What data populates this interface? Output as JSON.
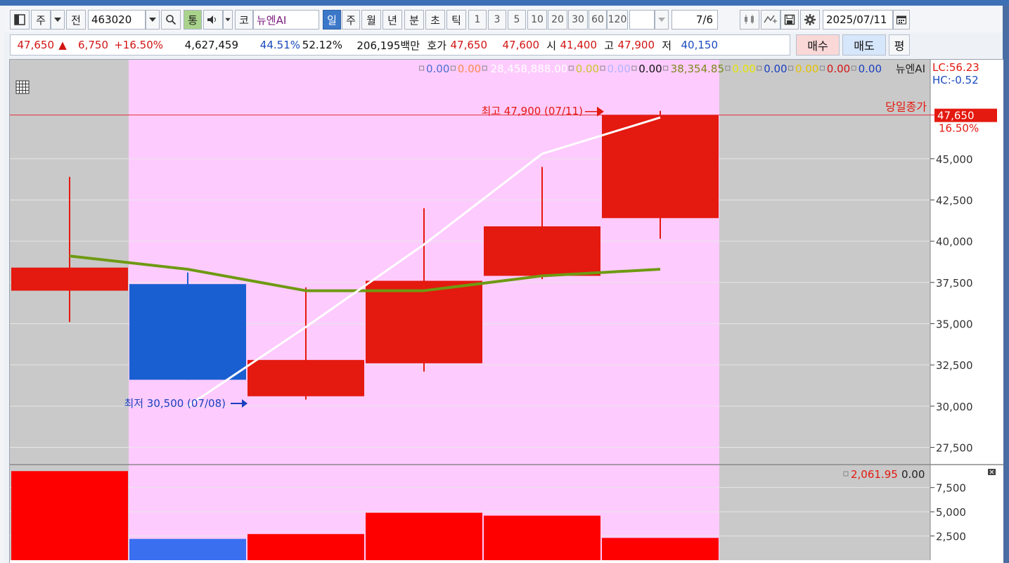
{
  "toolbar": {
    "period_type": "주",
    "prev_label": "전",
    "stock_code": "463020",
    "tong_label": "통",
    "market_label": "코",
    "stock_name": "뉴엔AI",
    "periods": [
      "일",
      "주",
      "월",
      "년",
      "분",
      "초",
      "틱"
    ],
    "active_period": "일",
    "intervals": [
      "1",
      "3",
      "5",
      "10",
      "20",
      "30",
      "60",
      "120"
    ],
    "date_count": "7",
    "date_count_suffix": "/6",
    "date": "2025/07/11"
  },
  "quote": {
    "price": "47,650",
    "change_arrow": "▲",
    "change": "6,750",
    "change_pct": "+16.50%",
    "volume": "4,627,459",
    "turnover_pct1": "44.51%",
    "turnover_pct2": "52.12%",
    "amount": "206,195백만",
    "hoga_label": "호가",
    "ask": "47,650",
    "bid": "47,600",
    "open_label": "시",
    "open": "41,400",
    "high_label": "고",
    "high": "47,900",
    "low_label": "저",
    "low": "40,150",
    "buy_label": "매수",
    "sell_label": "매도",
    "eval_label": "평"
  },
  "chart_legend": {
    "items": [
      {
        "text": "0.00",
        "color": "#4a6fd1"
      },
      {
        "text": "0.00",
        "color": "#ff8a50"
      },
      {
        "text": "28,458,888.00",
        "color": "#ffffff"
      },
      {
        "text": "0.00",
        "color": "#c6c62a"
      },
      {
        "text": "0.00",
        "color": "#b3b3ff"
      },
      {
        "text": "0.00",
        "color": "#111111"
      },
      {
        "text": "38,354.85",
        "color": "#7a8a1a"
      },
      {
        "text": "0.00",
        "color": "#e6e600"
      },
      {
        "text": "0.00",
        "color": "#1a3fbf"
      },
      {
        "text": "0.00",
        "color": "#e6c200"
      },
      {
        "text": "0.00",
        "color": "#d21414"
      },
      {
        "text": "0.00",
        "color": "#1a3fbf"
      }
    ],
    "stock_name": "뉴엔AI",
    "lc": "LC:56.23",
    "hc": "HC:-0.52"
  },
  "annotations": {
    "max_label": "최고 47,900 (07/11)",
    "min_label": "최저 30,500 (07/08)",
    "close_label": "당일종가",
    "close_price": "47,650",
    "close_pct": "16.50%"
  },
  "volume_legend": {
    "value1": "2,061.95",
    "value2": "0.00"
  },
  "chart_data": {
    "type": "candlestick",
    "candles": [
      {
        "open": 37000,
        "high": 43900,
        "low": 35100,
        "close": 38400,
        "color": "up"
      },
      {
        "open": 37400,
        "high": 38100,
        "low": 31600,
        "close": 31600,
        "color": "down"
      },
      {
        "open": 30600,
        "high": 37200,
        "low": 30400,
        "close": 32800,
        "color": "up"
      },
      {
        "open": 32600,
        "high": 42000,
        "low": 32100,
        "close": 37600,
        "color": "up"
      },
      {
        "open": 37900,
        "high": 44500,
        "low": 37700,
        "close": 40900,
        "color": "up"
      },
      {
        "open": 41400,
        "high": 47900,
        "low": 40150,
        "close": 47650,
        "color": "up"
      }
    ],
    "green_ma": [
      39100,
      38300,
      37000,
      37000,
      37900,
      38300
    ],
    "white_line": [
      null,
      30000,
      34800,
      39800,
      45300,
      47500
    ],
    "highlight_range": [
      1,
      5
    ],
    "yticks": [
      27500,
      30000,
      32500,
      35000,
      37500,
      40000,
      42500,
      45000
    ],
    "ytick_labels": [
      "27,500",
      "30,000",
      "32,500",
      "35,000",
      "37,500",
      "40,000",
      "42,500",
      "45,000"
    ],
    "ylim": [
      26500,
      51000
    ],
    "volume": {
      "values": [
        9200,
        2200,
        2700,
        4900,
        4600,
        2300
      ],
      "colors": [
        "up",
        "down",
        "up",
        "up",
        "up",
        "up"
      ],
      "yticks": [
        2500,
        5000,
        7500
      ],
      "ytick_labels": [
        "2,500",
        "5,000",
        "7,500"
      ],
      "ylim": [
        0,
        9800
      ]
    },
    "colors": {
      "up": "#e4190f",
      "down": "#1a5fd1",
      "highlight": "#fecbfe",
      "grid_bg": "#c9c9c9",
      "green_ma": "#6e9a12",
      "white_line": "#ffffff",
      "close_line": "#e0303a"
    }
  }
}
